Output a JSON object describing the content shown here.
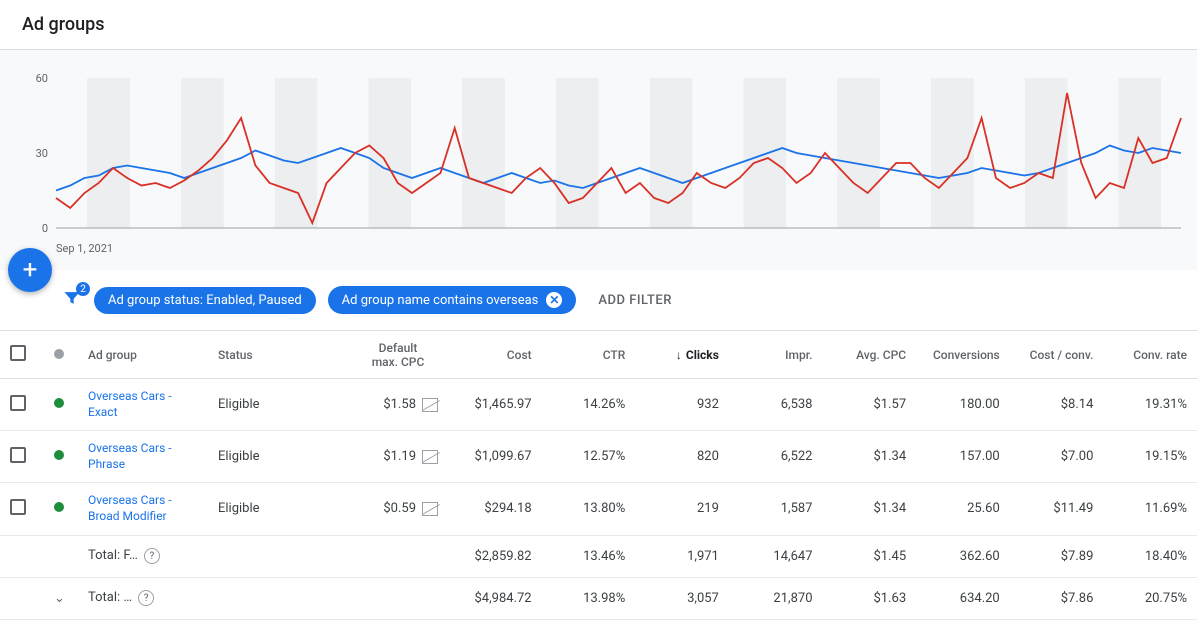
{
  "header": {
    "title": "Ad groups"
  },
  "chart": {
    "date_label": "Sep 1, 2021",
    "y_ticks": [
      "0",
      "30",
      "60"
    ]
  },
  "chart_data": {
    "type": "line",
    "ylim": [
      0,
      60
    ],
    "x_start_label": "Sep 1, 2021",
    "series": [
      {
        "name": "series-blue",
        "color": "#1a73e8",
        "values": [
          15,
          17,
          20,
          21,
          24,
          25,
          24,
          23,
          22,
          20,
          22,
          24,
          26,
          28,
          31,
          29,
          27,
          26,
          28,
          30,
          32,
          30,
          28,
          24,
          22,
          20,
          22,
          24,
          22,
          20,
          18,
          20,
          22,
          20,
          18,
          19,
          17,
          16,
          18,
          20,
          22,
          24,
          22,
          20,
          18,
          20,
          22,
          24,
          26,
          28,
          30,
          32,
          30,
          29,
          28,
          27,
          26,
          25,
          24,
          23,
          22,
          21,
          20,
          21,
          22,
          24,
          23,
          22,
          21,
          22,
          24,
          26,
          28,
          30,
          33,
          31,
          30,
          32,
          31,
          30
        ]
      },
      {
        "name": "series-red",
        "color": "#d93025",
        "values": [
          12,
          8,
          14,
          18,
          24,
          20,
          17,
          18,
          16,
          19,
          23,
          28,
          35,
          44,
          25,
          18,
          16,
          14,
          2,
          18,
          24,
          30,
          33,
          28,
          18,
          14,
          18,
          22,
          40,
          20,
          18,
          16,
          14,
          20,
          24,
          18,
          10,
          12,
          18,
          24,
          14,
          18,
          12,
          10,
          14,
          22,
          18,
          16,
          20,
          26,
          28,
          24,
          18,
          22,
          30,
          24,
          18,
          14,
          20,
          26,
          26,
          20,
          16,
          22,
          28,
          44,
          20,
          16,
          18,
          22,
          20,
          54,
          26,
          12,
          18,
          16,
          36,
          26,
          28,
          44
        ]
      }
    ]
  },
  "filters": {
    "badge_count": "2",
    "chip1": "Ad group status: Enabled, Paused",
    "chip2": "Ad group name contains overseas",
    "add_label": "ADD FILTER"
  },
  "columns": {
    "adgroup": "Ad group",
    "status": "Status",
    "maxcpc": "Default\nmax. CPC",
    "cost": "Cost",
    "ctr": "CTR",
    "clicks": "Clicks",
    "impr": "Impr.",
    "avgcpc": "Avg. CPC",
    "conv": "Conversions",
    "costconv": "Cost / conv.",
    "convrate": "Conv. rate"
  },
  "rows": [
    {
      "name": "Overseas Cars - Exact",
      "status": "Eligible",
      "maxcpc": "$1.58",
      "cost": "$1,465.97",
      "ctr": "14.26%",
      "clicks": "932",
      "impr": "6,538",
      "avgcpc": "$1.57",
      "conv": "180.00",
      "costconv": "$8.14",
      "convrate": "19.31%"
    },
    {
      "name": "Overseas Cars - Phrase",
      "status": "Eligible",
      "maxcpc": "$1.19",
      "cost": "$1,099.67",
      "ctr": "12.57%",
      "clicks": "820",
      "impr": "6,522",
      "avgcpc": "$1.34",
      "conv": "157.00",
      "costconv": "$7.00",
      "convrate": "19.15%"
    },
    {
      "name": "Overseas Cars - Broad Modifier",
      "status": "Eligible",
      "maxcpc": "$0.59",
      "cost": "$294.18",
      "ctr": "13.80%",
      "clicks": "219",
      "impr": "1,587",
      "avgcpc": "$1.34",
      "conv": "25.60",
      "costconv": "$11.49",
      "convrate": "11.69%"
    }
  ],
  "totals": [
    {
      "label": "Total: F…",
      "cost": "$2,859.82",
      "ctr": "13.46%",
      "clicks": "1,971",
      "impr": "14,647",
      "avgcpc": "$1.45",
      "conv": "362.60",
      "costconv": "$7.89",
      "convrate": "18.40%",
      "expandable": false,
      "help": true
    },
    {
      "label": "Total: …",
      "cost": "$4,984.72",
      "ctr": "13.98%",
      "clicks": "3,057",
      "impr": "21,870",
      "avgcpc": "$1.63",
      "conv": "634.20",
      "costconv": "$7.86",
      "convrate": "20.75%",
      "expandable": true,
      "help": true
    }
  ]
}
